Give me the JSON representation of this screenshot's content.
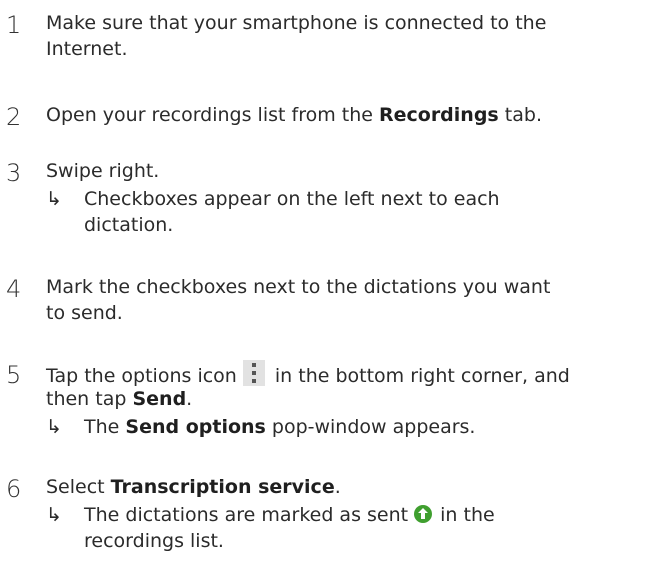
{
  "steps": [
    {
      "number": "1",
      "lines": [
        "Make sure that your smartphone is connected to the",
        "Internet."
      ]
    },
    {
      "number": "2",
      "text_a": "Open your recordings list from the ",
      "bold_a": "Recordings",
      "text_b": " tab."
    },
    {
      "number": "3",
      "text": "Swipe right.",
      "arrow": "↳",
      "result_lines": [
        "Checkboxes appear on the left next to each",
        "dictation."
      ]
    },
    {
      "number": "4",
      "lines": [
        "Mark the checkboxes next to the dictations you want",
        "to send."
      ]
    },
    {
      "number": "5",
      "text_a": "Tap the options icon",
      "text_b": " in the bottom right corner, and",
      "text_c": "then tap ",
      "bold_c": "Send",
      "text_d": ".",
      "arrow": "↳",
      "result_a": "The ",
      "result_bold": "Send options",
      "result_b": " pop-window appears."
    },
    {
      "number": "6",
      "text_a": "Select ",
      "bold_a": "Transcription service",
      "text_b": ".",
      "arrow": "↳",
      "result_a": "The dictations are marked as sent",
      "result_b": " in the",
      "result_line2": "recordings list."
    }
  ],
  "icons": {
    "options_icon": "vertical-dots-icon",
    "sent_icon": "upload-arrow-circle-icon",
    "sent_color": "#3f9f2f"
  }
}
